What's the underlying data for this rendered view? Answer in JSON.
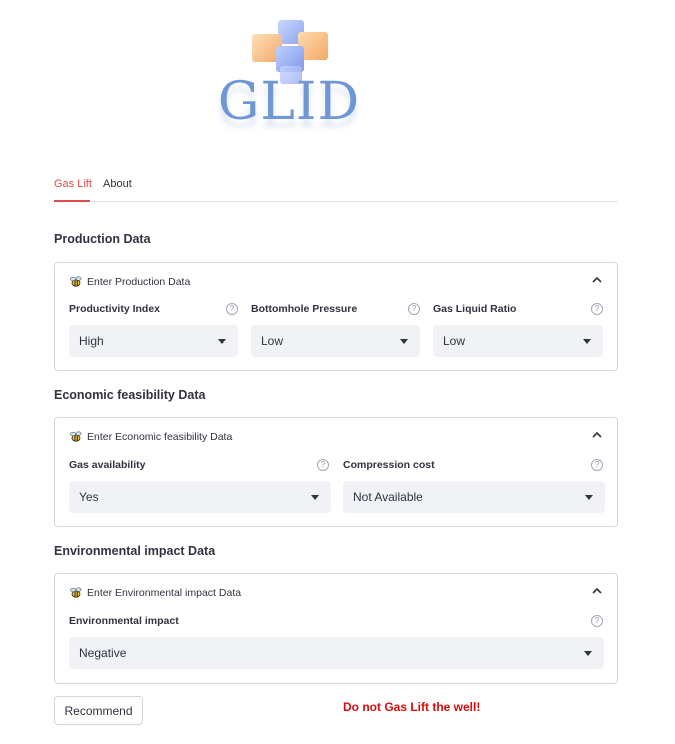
{
  "logo": {
    "text": "GLID"
  },
  "tabs": [
    {
      "label": "Gas Lift",
      "active": true
    },
    {
      "label": "About",
      "active": false
    }
  ],
  "sections": {
    "production": {
      "title": "Production Data",
      "expander_label": "Enter Production Data",
      "fields": [
        {
          "label": "Productivity Index",
          "value": "High"
        },
        {
          "label": "Bottomhole Pressure",
          "value": "Low"
        },
        {
          "label": "Gas Liquid Ratio",
          "value": "Low"
        }
      ]
    },
    "economic": {
      "title": "Economic feasibility Data",
      "expander_label": "Enter Economic feasibility Data",
      "fields": [
        {
          "label": "Gas availability",
          "value": "Yes"
        },
        {
          "label": "Compression cost",
          "value": "Not Available"
        }
      ]
    },
    "environmental": {
      "title": "Environmental impact Data",
      "expander_label": "Enter Environmental impact Data",
      "fields": [
        {
          "label": "Environmental impact",
          "value": "Negative"
        }
      ]
    }
  },
  "actions": {
    "recommend_label": "Recommend"
  },
  "result": {
    "text": "Do not Gas Lift the well!",
    "color": "#d40c0c"
  },
  "colors": {
    "accent": "#e24a4a",
    "select_bg": "#f0f2f6",
    "border": "#d6d6d9"
  },
  "icons": {
    "expander_icon": "bee-icon",
    "collapse": "chevron-up-icon",
    "dropdown": "caret-down-icon",
    "help": "help-circle-icon"
  }
}
